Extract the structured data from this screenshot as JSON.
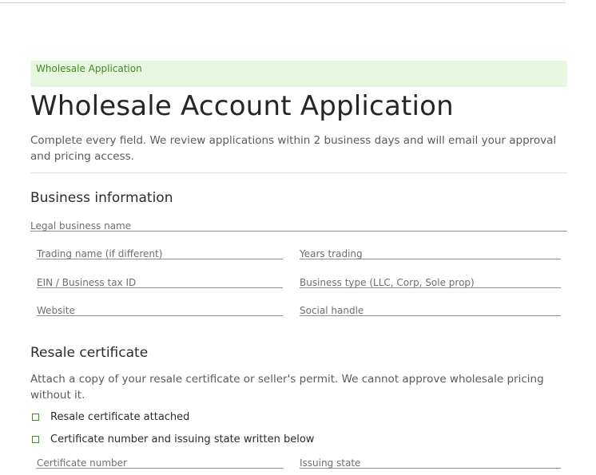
{
  "banner": {
    "label": "Wholesale Application"
  },
  "page": {
    "title": "Wholesale Account Application",
    "intro": "Complete every field. We review applications within 2 business days and will email your approval and pricing access."
  },
  "business": {
    "heading": "Business information",
    "legal_name_placeholder": "Legal business name",
    "trading_name_placeholder": "Trading name (if different)",
    "years_trading_placeholder": "Years trading",
    "ein_placeholder": "EIN / Business tax ID",
    "business_type_placeholder": "Business type (LLC, Corp, Sole prop)",
    "website_placeholder": "Website",
    "social_placeholder": "Social handle"
  },
  "resale": {
    "heading": "Resale certificate",
    "note": "Attach a copy of your resale certificate or seller's permit. We cannot approve wholesale pricing without it.",
    "check1_label": "Resale certificate attached",
    "check2_label": "Certificate number and issuing state written below",
    "cert_number_placeholder": "Certificate number",
    "issuing_state_placeholder": "Issuing state"
  },
  "colors": {
    "accent": "#3f8a21",
    "banner_bg": "#e8f8e0"
  }
}
